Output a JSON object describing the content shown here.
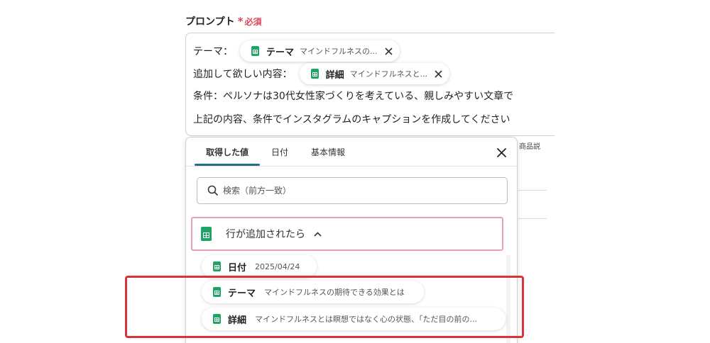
{
  "field": {
    "label": "プロンプト",
    "required_star": "*",
    "required_text": "必須"
  },
  "prompt": {
    "line1_prefix": "テーマ：",
    "chip1": {
      "key": "テーマ",
      "value": "マインドフルネスの..."
    },
    "line2_prefix": "追加して欲しい内容：",
    "chip2": {
      "key": "詳細",
      "value": "マインドフルネスと..."
    },
    "line3": "条件：ペルソナは30代女性家づくりを考えている、親しみやすい文章で",
    "line4": "上記の内容、条件でインスタグラムのキャプションを作成してください"
  },
  "side_text": "商品説",
  "panel": {
    "tabs": [
      {
        "label": "取得した値",
        "active": true
      },
      {
        "label": "日付",
        "active": false
      },
      {
        "label": "基本情報",
        "active": false
      }
    ],
    "search_placeholder": "検索（前方一致）",
    "group_label": "行が追加されたら",
    "items": [
      {
        "key": "日付",
        "value": "2025/04/24"
      },
      {
        "key": "テーマ",
        "value": "マインドフルネスの期待できる効果とは"
      },
      {
        "key": "詳細",
        "value": "マインドフルネスとは瞑想ではなく心の状態、「ただ目の前の..."
      }
    ]
  },
  "colors": {
    "accent_tab": "#236f87",
    "required": "#e0455a",
    "sheets_green": "#1fa463",
    "group_border": "#e8a0c2",
    "highlight": "#d6333d"
  },
  "icons": {
    "chip": "google-sheets-icon",
    "close": "close-icon",
    "search": "search-icon",
    "chevron": "chevron-up-icon"
  }
}
